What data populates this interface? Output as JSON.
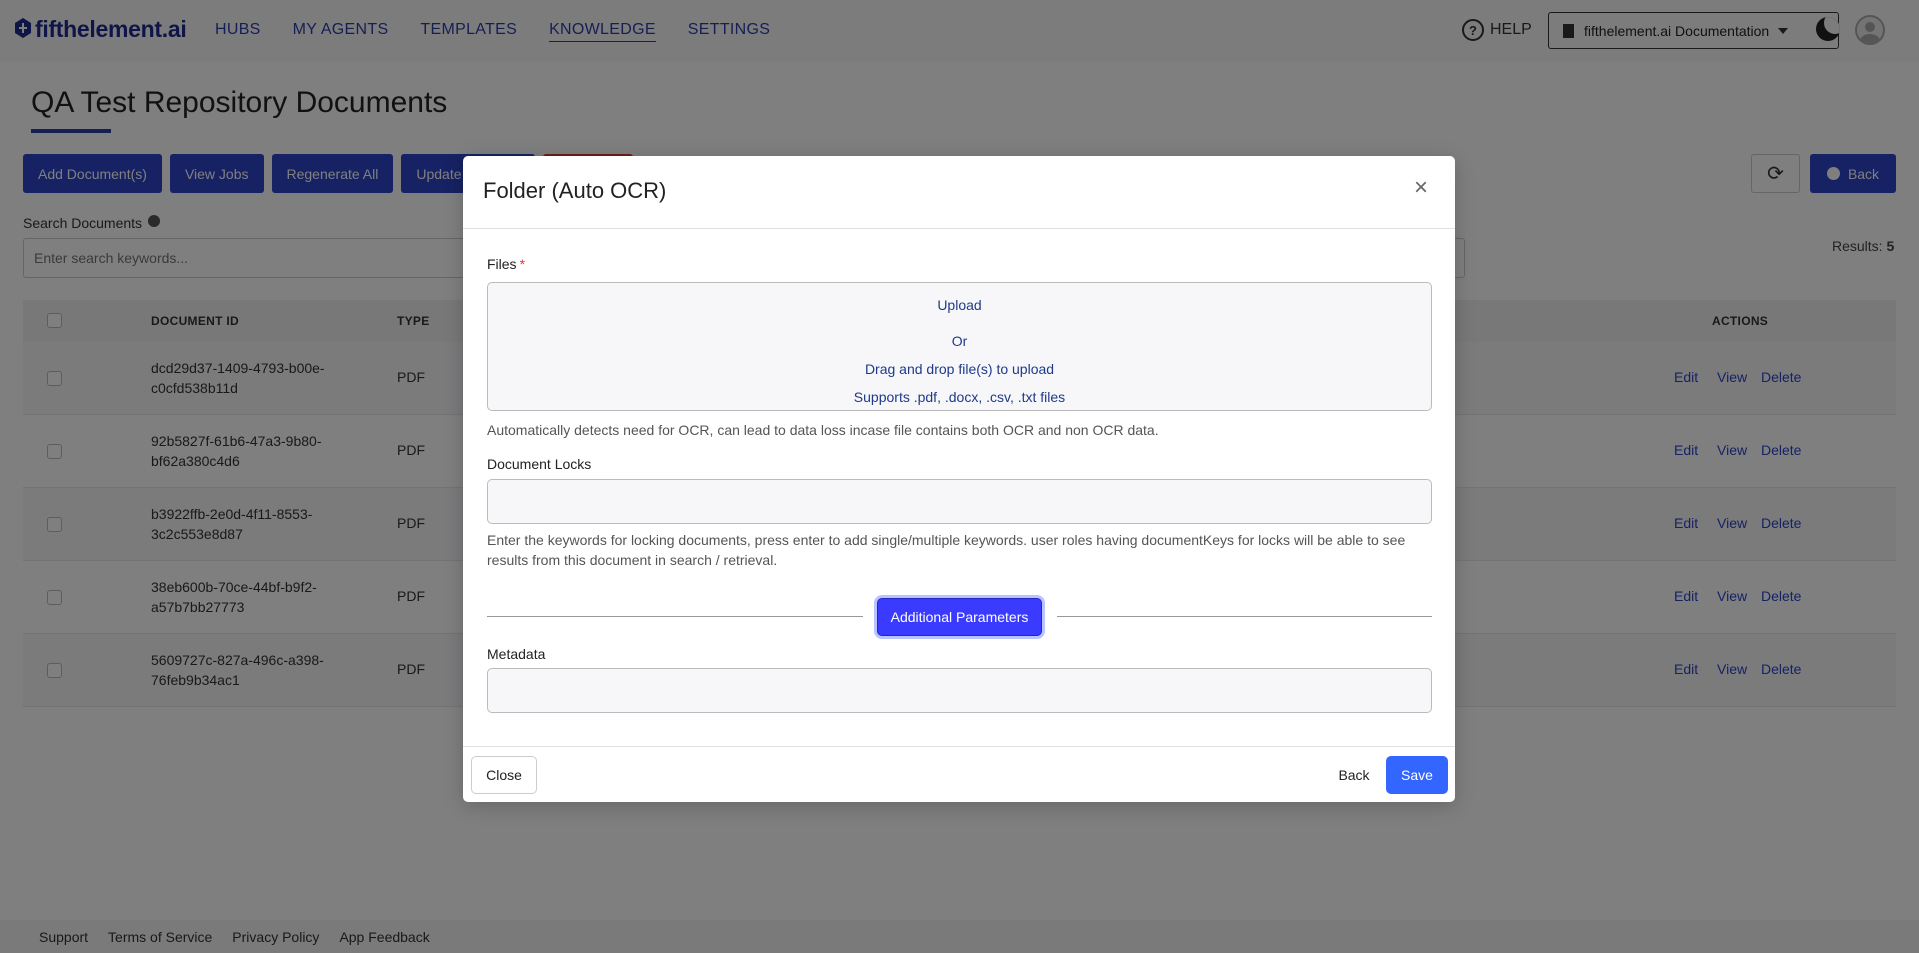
{
  "brand": {
    "logo_text": "fifthelement.ai"
  },
  "nav": {
    "items": [
      {
        "label": "HUBS"
      },
      {
        "label": "MY AGENTS"
      },
      {
        "label": "TEMPLATES"
      },
      {
        "label": "KNOWLEDGE",
        "active": true
      },
      {
        "label": "SETTINGS"
      }
    ],
    "help_label": "HELP",
    "org_selector": "fifthelement.ai Documentation"
  },
  "page": {
    "title": "QA Test Repository Documents",
    "buttons": {
      "add": "Add Document(s)",
      "jobs": "View Jobs",
      "regenerate": "Regenerate All",
      "update": "Update"
    },
    "back_label": "Back",
    "search_label": "Search Documents",
    "search_placeholder": "Enter search keywords...",
    "results_label": "Results:",
    "results_count": "5"
  },
  "table": {
    "headers": {
      "doc_id": "DOCUMENT ID",
      "type": "TYPE",
      "actions": "ACTIONS"
    },
    "rows": [
      {
        "id_line1": "dcd29d37-1409-4793-b00e-",
        "id_line2": "c0cfd538b11d",
        "type": "PDF"
      },
      {
        "id_line1": "92b5827f-61b6-47a3-9b80-",
        "id_line2": "bf62a380c4d6",
        "type": "PDF"
      },
      {
        "id_line1": "b3922ffb-2e0d-4f11-8553-",
        "id_line2": "3c2c553e8d87",
        "type": "PDF"
      },
      {
        "id_line1": "38eb600b-70ce-44bf-b9f2-",
        "id_line2": "a57b7bb27773",
        "type": "PDF"
      },
      {
        "id_line1": "5609727c-827a-496c-a398-",
        "id_line2": "76feb9b34ac1",
        "type": "PDF"
      }
    ],
    "actions": {
      "edit": "Edit",
      "view": "View",
      "delete": "Delete"
    }
  },
  "footer": {
    "links": [
      "Support",
      "Terms of Service",
      "Privacy Policy",
      "App Feedback"
    ]
  },
  "modal": {
    "title": "Folder (Auto OCR)",
    "close_glyph": "×",
    "files_label": "Files",
    "required_mark": "*",
    "dropzone": {
      "upload": "Upload",
      "or": "Or",
      "drag": "Drag and drop file(s) to upload",
      "supports": "Supports .pdf, .docx, .csv, .txt files"
    },
    "ocr_hint": "Automatically detects need for OCR, can lead to data loss incase file contains both OCR and non OCR data.",
    "locks_label": "Document Locks",
    "locks_hint": "Enter the keywords for locking documents, press enter to add single/multiple keywords. user roles having documentKeys for locks will be able to see results from this document in search / retrieval.",
    "additional_params": "Additional Parameters",
    "metadata_label": "Metadata",
    "close_btn": "Close",
    "back_btn": "Back",
    "save_btn": "Save"
  }
}
